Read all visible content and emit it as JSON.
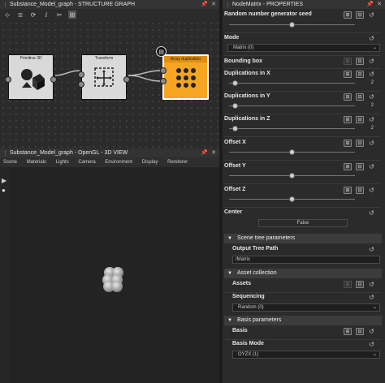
{
  "graph_panel": {
    "title": "Substance_Model_graph - STRUCTURE GRAPH",
    "nodes": {
      "primitive": {
        "label": "Primitive 3D"
      },
      "transform": {
        "label": "Transform"
      },
      "array": {
        "label": "Array duplication"
      }
    }
  },
  "view_panel": {
    "title": "Substance_Model_graph - OpenGL - 3D VIEW",
    "menu": [
      "Scene",
      "Materials",
      "Lights",
      "Camera",
      "Environment",
      "Display",
      "Renderer"
    ]
  },
  "properties": {
    "title": "NodeMatrix - PROPERTIES",
    "random_seed_label": "Random number generator seed",
    "mode_label": "Mode",
    "mode_value": "Matrix (0)",
    "bounding_box_label": "Bounding box",
    "dup_x_label": "Duplications in X",
    "dup_x_value": "2",
    "dup_y_label": "Duplications in Y",
    "dup_y_value": "2",
    "dup_z_label": "Duplications in Z",
    "dup_z_value": "2",
    "offset_x_label": "Offset X",
    "offset_y_label": "Offset Y",
    "offset_z_label": "Offset Z",
    "center_label": "Center",
    "center_value": "False",
    "scene_tree_section": "Scene tree parameters",
    "output_tree_path_label": "Output Tree Path",
    "output_tree_path_value": "/Matrix",
    "asset_collection_section": "Asset collection",
    "assets_label": "Assets",
    "sequencing_label": "Sequencing",
    "sequencing_value": "Random (0)",
    "basis_section": "Basis parameters",
    "basis_label": "Basis",
    "basis_mode_label": "Basis Mode",
    "basis_mode_value": "OYZX (1)"
  }
}
